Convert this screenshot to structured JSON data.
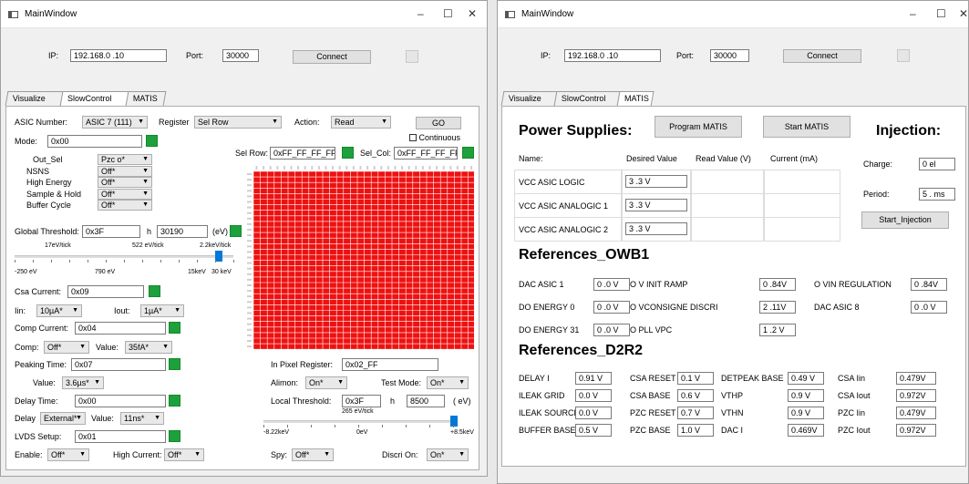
{
  "window_title": "MainWindow",
  "title_controls": {
    "min": "–",
    "max": "☐",
    "close": "✕"
  },
  "conn": {
    "ip_label": "IP:",
    "ip_value": "192.168.0 .10",
    "port_label": "Port:",
    "port_value": "30000",
    "connect": "Connect"
  },
  "tabs": [
    "Visualize",
    "SlowControl",
    "MATIS"
  ],
  "sc": {
    "asic_label": "ASIC Number:",
    "asic_value": "ASIC 7 (111)",
    "register_label": "Register",
    "register_value": "Sel Row",
    "action_label": "Action:",
    "action_value": "Read",
    "go": "GO",
    "continuous": "Continuous",
    "mode_label": "Mode:",
    "mode_value": "0x00",
    "mode_opts": [
      {
        "label": "Out_Sel",
        "value": "Pzc o*"
      },
      {
        "label": "NSNS",
        "value": "Off*"
      },
      {
        "label": "High Energy",
        "value": "Off*"
      },
      {
        "label": "Sample & Hold",
        "value": "Off*"
      },
      {
        "label": "Buffer Cycle",
        "value": "Off*"
      }
    ],
    "selrow_label": "Sel Row:",
    "selrow_value": "0xFF_FF_FF_FF",
    "selcol_label": "Sel_Col:",
    "selcol_value": "0xFF_FF_FF_FF",
    "gt_label": "Global Threshold:",
    "gt_value": "0x3F",
    "gt_h": "h",
    "gt_dec": "30190",
    "gt_unit": "(eV)",
    "gt_scale_top": [
      "17eV/tick",
      "522 eV/tick",
      "2.2keV/tick"
    ],
    "gt_scale_bottom": [
      "-250 eV",
      "790 eV",
      "15keV",
      "30 keV"
    ],
    "gt_level": 0.95,
    "csa_label": "Csa Current:",
    "csa_value": "0x09",
    "iin_label": "Iin:",
    "iin_value": "10µA*",
    "iout_label": "Iout:",
    "iout_value": "1µA*",
    "comp_cur_label": "Comp Current:",
    "comp_cur_value": "0x04",
    "comp_label": "Comp:",
    "comp_value": "Off*",
    "value_label": "Value:",
    "comp_val": "35fA*",
    "peak_label": "Peaking Time:",
    "peak_value": "0x07",
    "peak_val_label": "Value:",
    "peak_val": "3.6µs*",
    "delay_label": "Delay Time:",
    "delay_value": "0x00",
    "delay2_label": "Delay",
    "delay_sel": "External*",
    "delay_val_label": "Value:",
    "delay_val": "11ns*",
    "lvds_label": "LVDS Setup:",
    "lvds_value": "0x01",
    "enable_label": "Enable:",
    "enable_value": "Off*",
    "hc_label": "High Current:",
    "hc_value": "Off*",
    "inpix_label": "In Pixel Register:",
    "inpix_value": "0x02_FF",
    "alimon_label": "Alimon:",
    "alimon_value": "On*",
    "test_label": "Test Mode:",
    "test_value": "On*",
    "lt_label": "Local Threshold:",
    "lt_value": "0x3F",
    "lt_h": "h",
    "lt_dec": "8500",
    "lt_unit": "( eV)",
    "lt_scale_top": "265 eV/tick",
    "lt_scale_bottom": [
      "-8.22keV",
      "0eV",
      "+8.5keV"
    ],
    "lt_level": 1.0,
    "spy_label": "Spy:",
    "spy_value": "Off*",
    "discri_label": "Discri On:",
    "discri_value": "On*",
    "grid_color": "#ee1111"
  },
  "matis": {
    "ps_title": "Power Supplies:",
    "program": "Program MATIS",
    "start": "Start MATIS",
    "inj_title": "Injection:",
    "table_headers": [
      "Name:",
      "Desired Value",
      "Read Value (V)",
      "Current (mA)"
    ],
    "table_rows": [
      {
        "name": "VCC ASIC LOGIC",
        "desired": "3 .3 V"
      },
      {
        "name": "VCC ASIC ANALOGIC 1",
        "desired": "3 .3 V"
      },
      {
        "name": "VCC ASIC ANALOGIC 2",
        "desired": "3 .3 V"
      }
    ],
    "charge_label": "Charge:",
    "charge_value": "0    el",
    "period_label": "Period:",
    "period_value": "5    . ms",
    "start_inj": "Start_Injection",
    "owb1_title": "References_OWB1",
    "owb1": [
      {
        "label": "DAC ASIC 1",
        "value": "0 .0 V"
      },
      {
        "label": "O V INIT RAMP",
        "value": "0 .84V"
      },
      {
        "label": "O VIN REGULATION",
        "value": "0 .84V"
      },
      {
        "label": "DO ENERGY 0",
        "value": "0 .0 V"
      },
      {
        "label": "O VCONSIGNE DISCRI",
        "value": "2 .11V"
      },
      {
        "label": "DAC ASIC 8",
        "value": "0 .0 V"
      },
      {
        "label": "DO ENERGY 31",
        "value": "0 .0 V"
      },
      {
        "label": "O PLL VPC",
        "value": "1 .2 V"
      }
    ],
    "d2r2_title": "References_D2R2",
    "d2r2": [
      {
        "label": "DELAY I",
        "value": "0.91 V"
      },
      {
        "label": "CSA RESET",
        "value": "0.1  V"
      },
      {
        "label": "DETPEAK BASE",
        "value": "0.49 V"
      },
      {
        "label": "CSA Iin",
        "value": "0.479V"
      },
      {
        "label": "ILEAK GRID",
        "value": "0.0  V"
      },
      {
        "label": "CSA BASE",
        "value": "0.6  V"
      },
      {
        "label": "VTHP",
        "value": "0.9  V"
      },
      {
        "label": "CSA Iout",
        "value": "0.972V"
      },
      {
        "label": "ILEAK SOURCE",
        "value": "0.0  V"
      },
      {
        "label": "PZC RESET",
        "value": "0.7  V"
      },
      {
        "label": "VTHN",
        "value": "0.9  V"
      },
      {
        "label": "PZC Iin",
        "value": "0.479V"
      },
      {
        "label": "BUFFER BASE",
        "value": "0.5  V"
      },
      {
        "label": "PZC BASE",
        "value": "1.0  V"
      },
      {
        "label": "DAC I",
        "value": "0.469V"
      },
      {
        "label": "PZC Iout",
        "value": "0.972V"
      }
    ]
  }
}
